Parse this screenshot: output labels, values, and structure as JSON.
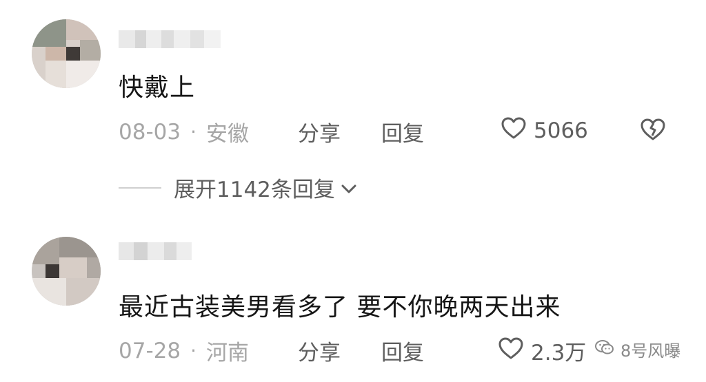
{
  "comments": [
    {
      "text": "快戴上",
      "date": "08-03",
      "separator": "·",
      "location": "安徽",
      "share_label": "分享",
      "reply_label": "回复",
      "likes": "5066",
      "expand_label": "展开1142条回复"
    },
    {
      "text": "最近古装美男看多了  要不你晚两天出来",
      "date": "07-28",
      "separator": "·",
      "location": "河南",
      "share_label": "分享",
      "reply_label": "回复",
      "likes": "2.3万"
    }
  ],
  "watermark": {
    "label": "8号风曝"
  },
  "icons": {
    "like": "heart-outline-icon",
    "dislike": "broken-heart-icon",
    "expand": "chevron-down-icon",
    "watermark": "wechat-icon"
  },
  "colors": {
    "text": "#161616",
    "meta": "#a6a6a6",
    "action": "#5e5e5e"
  }
}
